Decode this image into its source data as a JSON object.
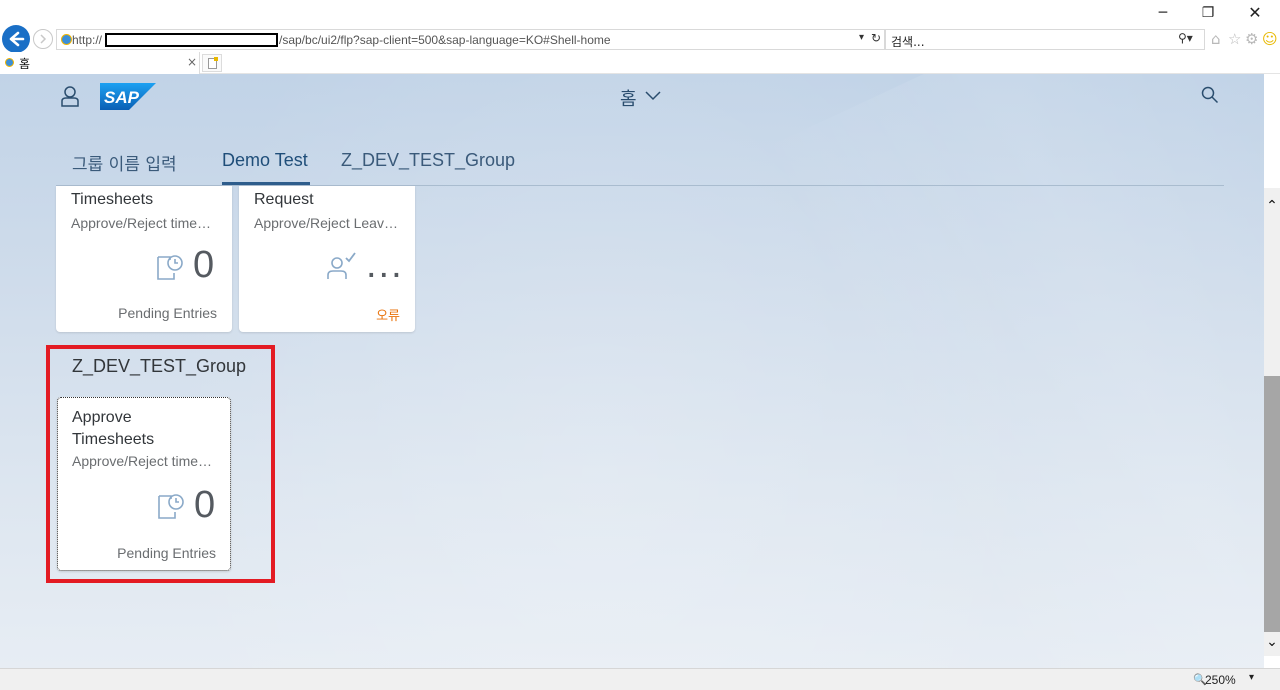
{
  "browser": {
    "url_prefix": "http://",
    "url_suffix": "/sap/bc/ui2/flp?sap-client=500&sap-language=KO#Shell-home",
    "search_placeholder": "검색...",
    "tab_title": "홈",
    "zoom": "250%"
  },
  "shell": {
    "title": "홈",
    "logo_text": "SAP"
  },
  "anchor_bar": {
    "items": [
      "그룹 이름 입력",
      "Demo Test",
      "Z_DEV_TEST_Group"
    ],
    "selected": "Demo Test"
  },
  "groups": {
    "demo_test": {
      "tiles": [
        {
          "title": "Timesheets",
          "subtitle": "Approve/Reject time…",
          "kpi": "0",
          "footer": "Pending Entries",
          "icon": "timesheet-icon"
        },
        {
          "title": "Request",
          "subtitle": "Approve/Reject Leav…",
          "kpi": "...",
          "footer": "오류",
          "icon": "person-check-icon"
        }
      ]
    },
    "z_dev_test_group": {
      "title": "Z_DEV_TEST_Group",
      "tiles": [
        {
          "title_line1": "Approve",
          "title_line2": "Timesheets",
          "subtitle": "Approve/Reject time…",
          "kpi": "0",
          "footer": "Pending Entries",
          "icon": "timesheet-icon"
        }
      ]
    }
  },
  "colors": {
    "highlight": "#e31b23",
    "error_text": "#e9730c",
    "sap_blue": "#0a6ed1"
  }
}
